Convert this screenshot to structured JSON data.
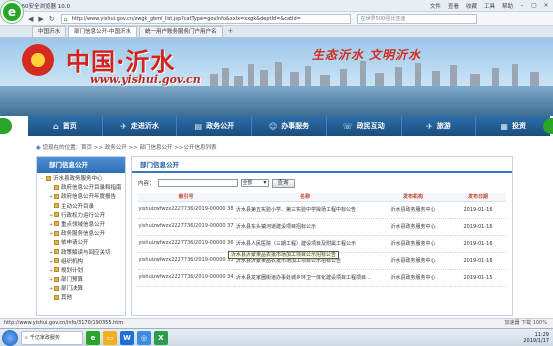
{
  "browser": {
    "window_title": "360安全浏览器 10.0",
    "top_links": [
      "文件",
      "查看",
      "收藏",
      "工具",
      "帮助"
    ],
    "url": "http://www.yishui.gov.cn/zwgk_gbml_list.jsp?catType=govInfo&xxlx=xxgk&deptId=&catId=",
    "search_placeholder": "在世界500强比亚迪",
    "tabs": [
      {
        "label": "中国沂水",
        "active": false
      },
      {
        "label": "部门信息公开-中国沂水",
        "active": true
      },
      {
        "label": "统一用户账务服务门户用户名",
        "active": false
      }
    ],
    "status_url": "http://www.yishui.gov.cn/info/3170/190355.htm",
    "status_right": "加速器   下载   100%"
  },
  "site": {
    "name": "中国·沂水",
    "url_text": "www.yishui.gov.cn",
    "slogan": "生态沂水 文明沂水",
    "nav": [
      {
        "label": "首页",
        "icon": "home-icon",
        "glyph": "⌂"
      },
      {
        "label": "走进沂水",
        "icon": "compass-icon",
        "glyph": "✈"
      },
      {
        "label": "政务公开",
        "icon": "document-icon",
        "glyph": "▤"
      },
      {
        "label": "办事服务",
        "icon": "user-icon",
        "glyph": "☺"
      },
      {
        "label": "政民互动",
        "icon": "chat-icon",
        "glyph": "☏"
      },
      {
        "label": "旅游",
        "icon": "plane-icon",
        "glyph": "✈"
      },
      {
        "label": "投资",
        "icon": "chart-icon",
        "glyph": "▦"
      }
    ]
  },
  "breadcrumb": "您现在的位置：首页 >> 政务公开 >> 部门信息公开 >>公开信息列表",
  "sidebar": {
    "title": "部门信息公开",
    "items": [
      {
        "label": "沂水县政务服务中心",
        "sub": false,
        "expand": "-"
      },
      {
        "label": "政府信息公开目录和指南",
        "sub": true,
        "expand": ""
      },
      {
        "label": "政府信息公开年度报告",
        "sub": true,
        "expand": "+"
      },
      {
        "label": "主动公开目录",
        "sub": true,
        "expand": ""
      },
      {
        "label": "行政权力运行公开",
        "sub": true,
        "expand": "+"
      },
      {
        "label": "重点领域信息公开",
        "sub": true,
        "expand": "+"
      },
      {
        "label": "政务服务信息公开",
        "sub": true,
        "expand": "+"
      },
      {
        "label": "依申请公开",
        "sub": true,
        "expand": ""
      },
      {
        "label": "政策解读与回应关切",
        "sub": true,
        "expand": "+"
      },
      {
        "label": "组织机构",
        "sub": true,
        "expand": "+"
      },
      {
        "label": "规划计划",
        "sub": true,
        "expand": "+"
      },
      {
        "label": "部门预算",
        "sub": true,
        "expand": "+"
      },
      {
        "label": "部门决算",
        "sub": true,
        "expand": "+"
      },
      {
        "label": "其他",
        "sub": true,
        "expand": ""
      }
    ]
  },
  "content": {
    "title": "部门信息公开",
    "filter_label": "内容：",
    "select_value": "全部",
    "query_button": "查询",
    "columns": [
      "索引号",
      "名称",
      "发布机构",
      "发布日期"
    ],
    "rows": [
      {
        "index": "yishuizwfwzx2227736/2019-00000 38",
        "name": "沂水县第五实验小学、第三实验中学操场工程中标公告",
        "org": "沂水县政务服务中心",
        "date": "2019-01-16"
      },
      {
        "index": "yishuizwfwzx2227736/2019-00000 37",
        "name": "沂水县东头镇河道建设项目招标公示",
        "org": "沂水县政务服务中心",
        "date": "2019-01-16"
      },
      {
        "index": "yishuizwfwzx2227736/2019-00000 36",
        "name": "沂水县人民医院（三期工程）建设项目及附属工程公示",
        "org": "沂水县政务服务中心",
        "date": "2019-01-16"
      },
      {
        "index": "yishuizwfwzx2227736/2019-00000 35",
        "name": "沂水县沂蒙果品农批市场加工项目公示招标公告",
        "org": "沂水县政务服务中心",
        "date": "2019-01-16"
      },
      {
        "index": "yishuizwfwzx2227736/2019-00000 34",
        "name": "沂水县龙家圈街道办事处城乡环卫一体化建设项目工程项目...",
        "org": "沂水县政务服务中心",
        "date": "2019-01-15"
      }
    ],
    "tooltip": "沂水县沂蒙果品农批市场加工项目公示招标公告"
  },
  "taskbar": {
    "search_text": "千亿家政服务",
    "time": "11:29",
    "date": "2019/1/17"
  }
}
